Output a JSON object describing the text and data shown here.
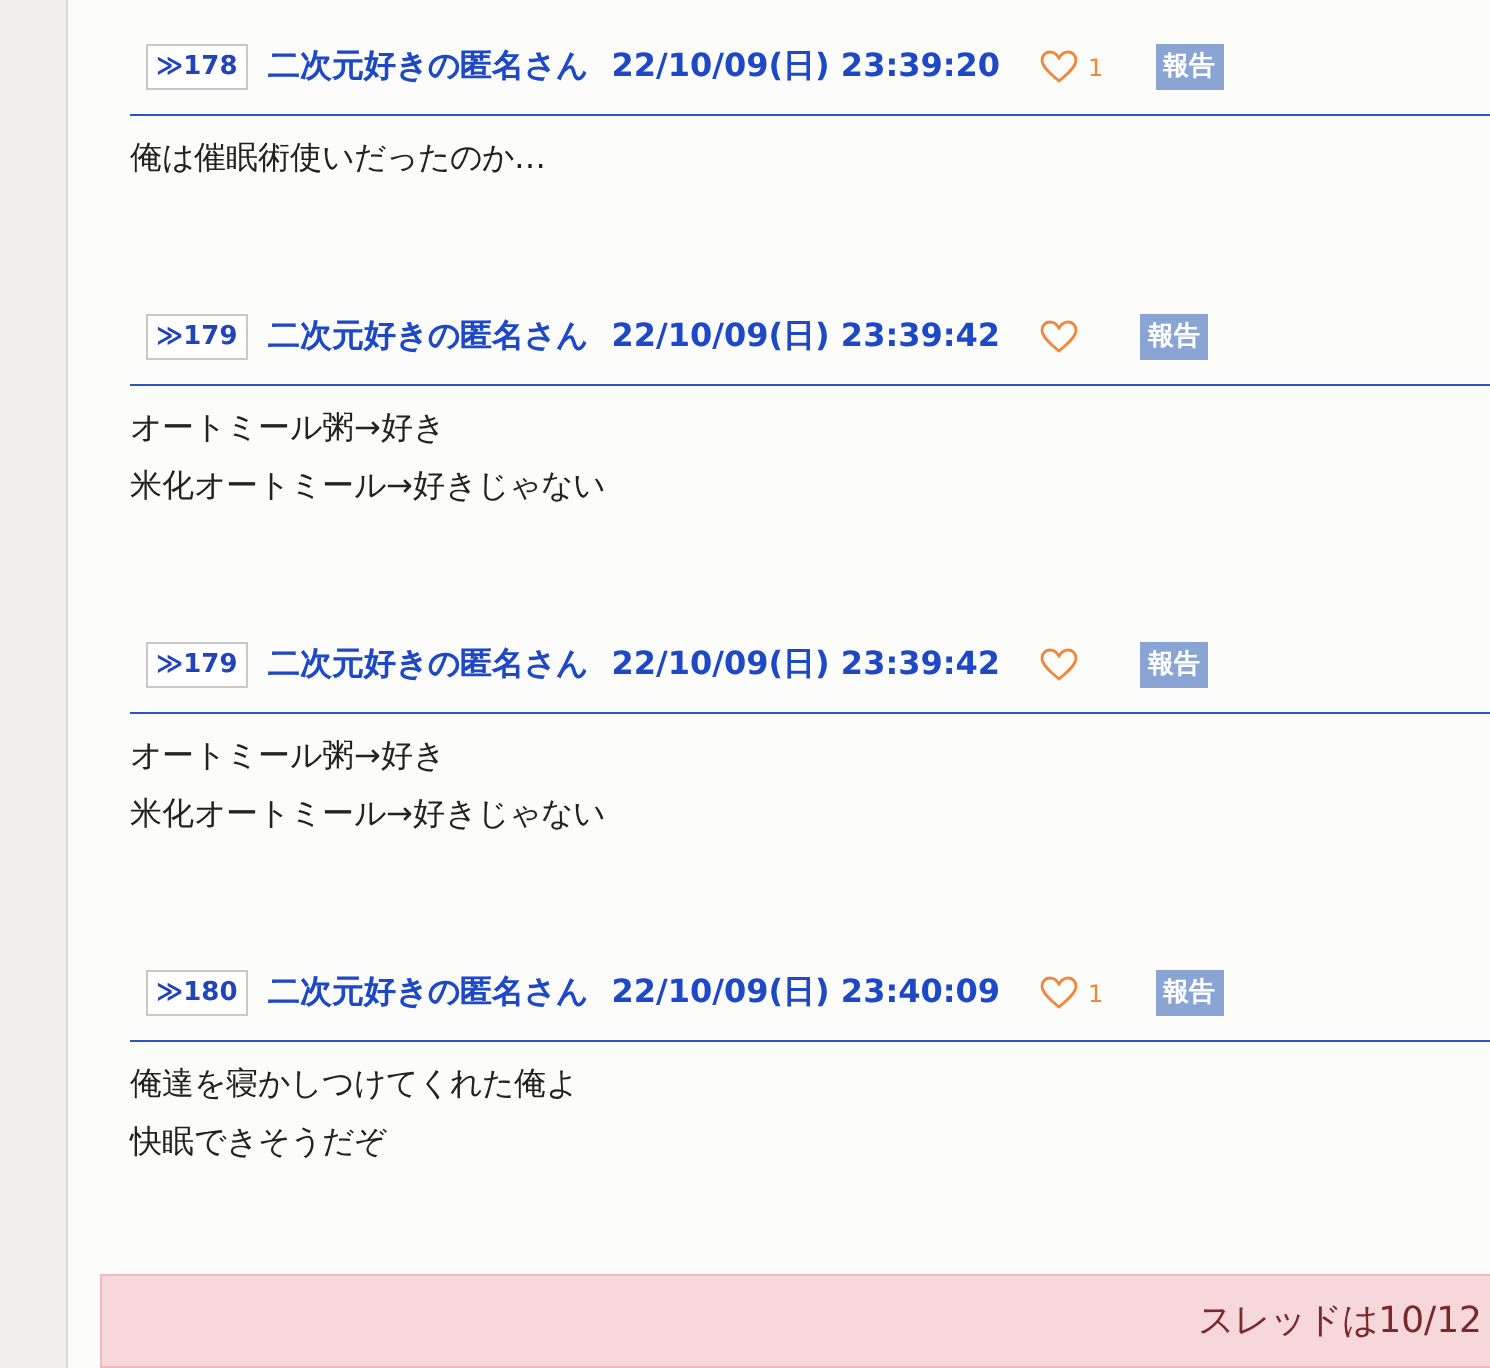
{
  "posts": [
    {
      "number": "≫178",
      "name": "二次元好きの匿名さん",
      "date": "22/10/09(日) 23:39:20",
      "likes": "1",
      "report": "報告",
      "body": [
        "俺は催眠術使いだったのか…"
      ]
    },
    {
      "number": "≫179",
      "name": "二次元好きの匿名さん",
      "date": "22/10/09(日) 23:39:42",
      "report": "報告",
      "body": [
        "オートミール粥→好き",
        "米化オートミール→好きじゃない"
      ]
    },
    {
      "number": "≫179",
      "name": "二次元好きの匿名さん",
      "date": "22/10/09(日) 23:39:42",
      "report": "報告",
      "body": [
        "オートミール粥→好き",
        "米化オートミール→好きじゃない"
      ]
    },
    {
      "number": "≫180",
      "name": "二次元好きの匿名さん",
      "date": "22/10/09(日) 23:40:09",
      "likes": "1",
      "report": "報告",
      "body": [
        "俺達を寝かしつけてくれた俺よ",
        "快眠できそうだぞ"
      ]
    }
  ],
  "notice": "スレッドは10/12"
}
